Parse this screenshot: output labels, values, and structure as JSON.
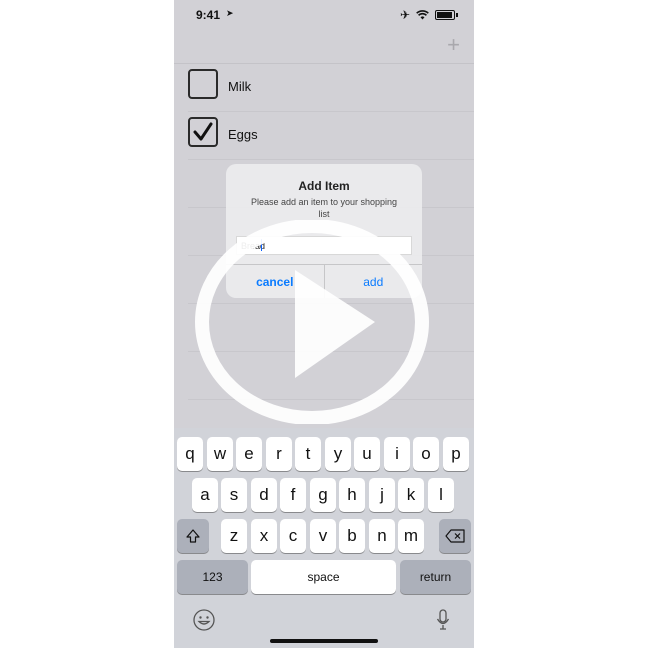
{
  "status_bar": {
    "time": "9:41"
  },
  "nav": {
    "add_icon": "plus-icon"
  },
  "list": {
    "items": [
      {
        "label": "Milk",
        "checked": false
      },
      {
        "label": "Eggs",
        "checked": true
      }
    ]
  },
  "alert": {
    "title": "Add Item",
    "message": "Please add an item to your shopping list",
    "input_value": "Bread",
    "cancel_label": "cancel",
    "add_label": "add"
  },
  "keyboard": {
    "row1": [
      "q",
      "w",
      "e",
      "r",
      "t",
      "y",
      "u",
      "i",
      "o",
      "p"
    ],
    "row2": [
      "a",
      "s",
      "d",
      "f",
      "g",
      "h",
      "j",
      "k",
      "l"
    ],
    "row3": [
      "z",
      "x",
      "c",
      "v",
      "b",
      "n",
      "m"
    ],
    "numbers_label": "123",
    "space_label": "space",
    "return_label": "return",
    "icons": [
      "shift-icon",
      "delete-icon",
      "emoji-icon",
      "microphone-icon"
    ]
  },
  "colors": {
    "accent": "#0a7bff",
    "background": "#d2d1d6"
  }
}
